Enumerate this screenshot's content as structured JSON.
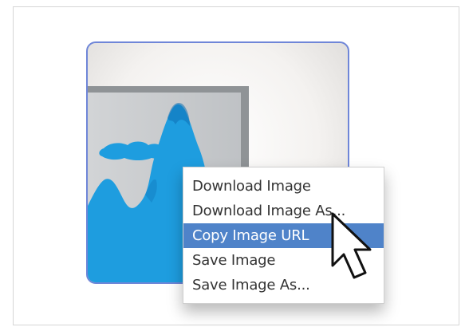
{
  "context_menu": {
    "items": [
      {
        "label": "Download Image"
      },
      {
        "label": "Download Image As..."
      },
      {
        "label": "Copy Image URL",
        "selected": true
      },
      {
        "label": "Save Image"
      },
      {
        "label": "Save Image As..."
      }
    ]
  },
  "colors": {
    "card_border": "#6f86d8",
    "menu_highlight": "#4f83c9",
    "mountain": "#1e9ddf",
    "photo_panel": "#c9cbce"
  },
  "icons": {
    "picture": "landscape-picture-icon",
    "cursor": "arrow-cursor-icon"
  }
}
